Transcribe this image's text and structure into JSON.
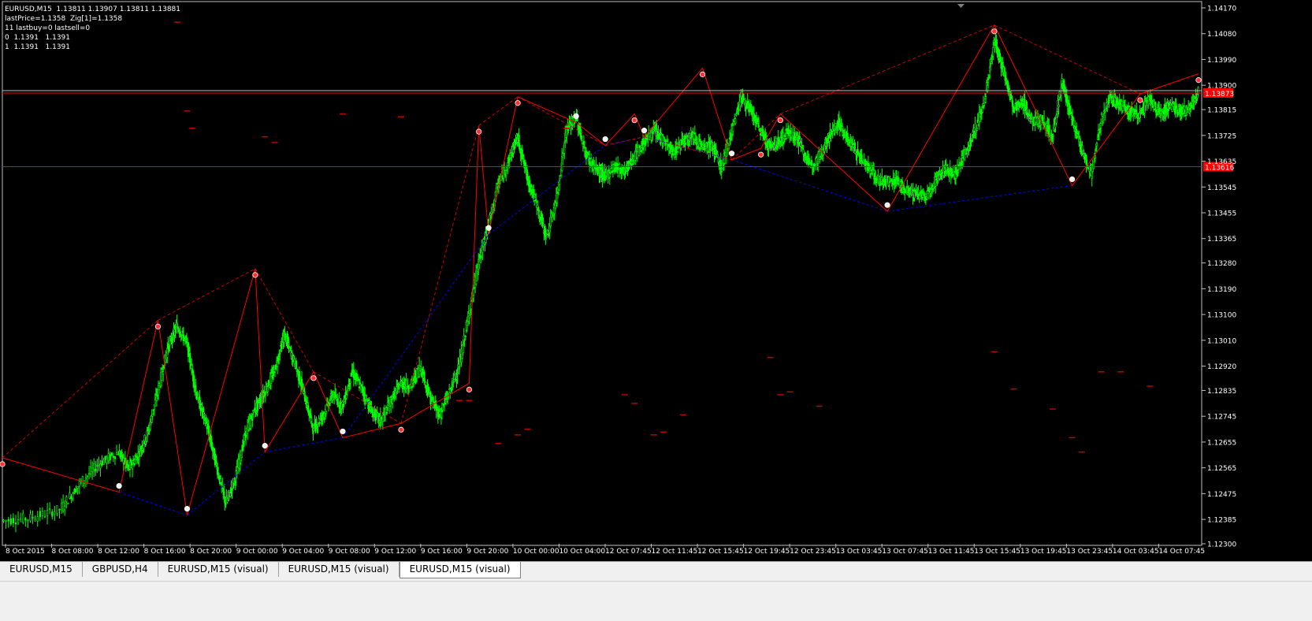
{
  "chart_data": {
    "type": "candlestick",
    "symbol_line": "EURUSD,M15  1.13811 1.13907 1.13811 1.13881",
    "info_lines": [
      "lastPrice=1.1358  Zig[1]=1.1358",
      "11 lastbuy=0 lastsell=0",
      "0  1.1391   1.1391",
      "1  1.1391   1.1391"
    ],
    "y_ticks": [
      "1.14170",
      "1.14080",
      "1.13990",
      "1.13900",
      "1.13815",
      "1.13725",
      "1.13635",
      "1.13545",
      "1.13455",
      "1.13365",
      "1.13280",
      "1.13190",
      "1.13100",
      "1.13010",
      "1.12920",
      "1.12835",
      "1.12745",
      "1.12655",
      "1.12565",
      "1.12475",
      "1.12385",
      "1.12300"
    ],
    "ylim": [
      1.123,
      1.1417
    ],
    "x_ticks": [
      "8 Oct 2015",
      "8 Oct 08:00",
      "8 Oct 12:00",
      "8 Oct 16:00",
      "8 Oct 20:00",
      "9 Oct 00:00",
      "9 Oct 04:00",
      "9 Oct 08:00",
      "9 Oct 12:00",
      "9 Oct 16:00",
      "9 Oct 20:00",
      "10 Oct 00:00",
      "10 Oct 04:00",
      "12 Oct 07:45",
      "12 Oct 11:45",
      "12 Oct 15:45",
      "12 Oct 19:45",
      "12 Oct 23:45",
      "13 Oct 03:45",
      "13 Oct 07:45",
      "13 Oct 11:45",
      "13 Oct 15:45",
      "13 Oct 19:45",
      "13 Oct 23:45",
      "14 Oct 03:45",
      "14 Oct 07:45"
    ],
    "hlines": [
      {
        "price": 1.13873,
        "label": "1.13873",
        "color": "#ff0000"
      },
      {
        "price": 1.13616,
        "label": "1.13616",
        "color": "#ff0000"
      }
    ],
    "close_path": [
      [
        0,
        1.1238
      ],
      [
        3,
        1.1239
      ],
      [
        6,
        1.1242
      ],
      [
        8,
        1.1251
      ],
      [
        10,
        1.1258
      ],
      [
        12,
        1.1262
      ],
      [
        13,
        1.1256
      ],
      [
        14,
        1.1261
      ],
      [
        15,
        1.1269
      ],
      [
        16,
        1.1283
      ],
      [
        17,
        1.1298
      ],
      [
        18,
        1.1306
      ],
      [
        19,
        1.13
      ],
      [
        20,
        1.1282
      ],
      [
        21,
        1.1272
      ],
      [
        22,
        1.1258
      ],
      [
        23,
        1.1244
      ],
      [
        24,
        1.1253
      ],
      [
        25,
        1.1268
      ],
      [
        26,
        1.1277
      ],
      [
        27,
        1.1283
      ],
      [
        28,
        1.129
      ],
      [
        29,
        1.1303
      ],
      [
        30,
        1.1294
      ],
      [
        31,
        1.1283
      ],
      [
        32,
        1.127
      ],
      [
        33,
        1.1275
      ],
      [
        34,
        1.1282
      ],
      [
        35,
        1.1278
      ],
      [
        36,
        1.129
      ],
      [
        37,
        1.1284
      ],
      [
        38,
        1.1276
      ],
      [
        39,
        1.1273
      ],
      [
        40,
        1.128
      ],
      [
        41,
        1.1286
      ],
      [
        42,
        1.1285
      ],
      [
        43,
        1.1292
      ],
      [
        44,
        1.1281
      ],
      [
        45,
        1.1275
      ],
      [
        46,
        1.1283
      ],
      [
        47,
        1.1292
      ],
      [
        48,
        1.131
      ],
      [
        49,
        1.1328
      ],
      [
        50,
        1.1341
      ],
      [
        51,
        1.1355
      ],
      [
        52,
        1.1363
      ],
      [
        53,
        1.1372
      ],
      [
        54,
        1.1358
      ],
      [
        55,
        1.1348
      ],
      [
        56,
        1.1337
      ],
      [
        57,
        1.135
      ],
      [
        58,
        1.1374
      ],
      [
        59,
        1.1379
      ],
      [
        60,
        1.1366
      ],
      [
        61,
        1.1361
      ],
      [
        62,
        1.1358
      ],
      [
        63,
        1.1362
      ],
      [
        64,
        1.136
      ],
      [
        65,
        1.1365
      ],
      [
        66,
        1.137
      ],
      [
        67,
        1.1374
      ],
      [
        68,
        1.1371
      ],
      [
        69,
        1.1366
      ],
      [
        70,
        1.1371
      ],
      [
        71,
        1.1373
      ],
      [
        72,
        1.1368
      ],
      [
        73,
        1.1369
      ],
      [
        74,
        1.1361
      ],
      [
        75,
        1.1374
      ],
      [
        76,
        1.1386
      ],
      [
        77,
        1.1381
      ],
      [
        78,
        1.1374
      ],
      [
        79,
        1.1368
      ],
      [
        80,
        1.1371
      ],
      [
        81,
        1.1374
      ],
      [
        82,
        1.137
      ],
      [
        83,
        1.1362
      ],
      [
        84,
        1.1365
      ],
      [
        85,
        1.1372
      ],
      [
        86,
        1.1377
      ],
      [
        87,
        1.1371
      ],
      [
        88,
        1.1366
      ],
      [
        89,
        1.1362
      ],
      [
        90,
        1.1357
      ],
      [
        91,
        1.1356
      ],
      [
        92,
        1.1357
      ],
      [
        93,
        1.1353
      ],
      [
        94,
        1.1352
      ],
      [
        95,
        1.1351
      ],
      [
        96,
        1.1357
      ],
      [
        97,
        1.1361
      ],
      [
        98,
        1.1359
      ],
      [
        99,
        1.1366
      ],
      [
        100,
        1.1374
      ],
      [
        101,
        1.1384
      ],
      [
        102,
        1.1405
      ],
      [
        103,
        1.1395
      ],
      [
        104,
        1.1382
      ],
      [
        105,
        1.1384
      ],
      [
        106,
        1.1377
      ],
      [
        107,
        1.1378
      ],
      [
        108,
        1.1372
      ],
      [
        109,
        1.1391
      ],
      [
        110,
        1.1378
      ],
      [
        111,
        1.1368
      ],
      [
        112,
        1.1359
      ],
      [
        113,
        1.1378
      ],
      [
        114,
        1.1386
      ],
      [
        115,
        1.1383
      ],
      [
        116,
        1.1381
      ],
      [
        117,
        1.138
      ],
      [
        118,
        1.1385
      ],
      [
        119,
        1.138
      ],
      [
        120,
        1.1383
      ],
      [
        121,
        1.1381
      ],
      [
        122,
        1.1381
      ],
      [
        123,
        1.1388
      ]
    ],
    "zigzag_red": [
      [
        0,
        1.126
      ],
      [
        12,
        1.1248
      ],
      [
        16,
        1.1308
      ],
      [
        19,
        1.124
      ],
      [
        26,
        1.1326
      ],
      [
        27,
        1.1262
      ],
      [
        32,
        1.129
      ],
      [
        35,
        1.1267
      ],
      [
        41,
        1.1272
      ],
      [
        48,
        1.1286
      ],
      [
        49,
        1.1376
      ],
      [
        50,
        1.1338
      ],
      [
        53,
        1.1386
      ],
      [
        59,
        1.1377
      ],
      [
        62,
        1.1369
      ],
      [
        65,
        1.138
      ],
      [
        66,
        1.1372
      ],
      [
        72,
        1.1396
      ],
      [
        75,
        1.1364
      ],
      [
        78,
        1.1368
      ],
      [
        80,
        1.138
      ],
      [
        91,
        1.1346
      ],
      [
        102,
        1.1411
      ],
      [
        110,
        1.1355
      ],
      [
        117,
        1.1387
      ],
      [
        123,
        1.1394
      ]
    ],
    "levels_red": [
      [
        18,
        1.1412
      ],
      [
        19,
        1.1381
      ],
      [
        19.5,
        1.1375
      ],
      [
        27,
        1.1372
      ],
      [
        28,
        1.137
      ],
      [
        35,
        1.138
      ],
      [
        41,
        1.1379
      ],
      [
        47,
        1.128
      ],
      [
        48,
        1.128
      ],
      [
        51,
        1.1265
      ],
      [
        53,
        1.1268
      ],
      [
        54,
        1.127
      ],
      [
        58,
        1.1375
      ],
      [
        64,
        1.1282
      ],
      [
        65,
        1.1279
      ],
      [
        67,
        1.1268
      ],
      [
        68,
        1.1269
      ],
      [
        70,
        1.1275
      ],
      [
        79,
        1.1295
      ],
      [
        80,
        1.1282
      ],
      [
        81,
        1.1283
      ],
      [
        84,
        1.1278
      ],
      [
        102,
        1.1297
      ],
      [
        104,
        1.1284
      ],
      [
        108,
        1.1277
      ],
      [
        110,
        1.1267
      ],
      [
        111,
        1.1262
      ],
      [
        113,
        1.129
      ],
      [
        115,
        1.129
      ],
      [
        118,
        1.1285
      ]
    ],
    "legend": "none",
    "grid": false
  },
  "tabs": [
    {
      "label": "EURUSD,M15",
      "active": false
    },
    {
      "label": "GBPUSD,H4",
      "active": false
    },
    {
      "label": "EURUSD,M15 (visual)",
      "active": false
    },
    {
      "label": "EURUSD,M15 (visual)",
      "active": false
    },
    {
      "label": "EURUSD,M15 (visual)",
      "active": true
    }
  ],
  "colors": {
    "background": "#000000",
    "bull": "#00ff00",
    "bear": "#ffffff",
    "zigzag": "#ff0000",
    "trend_blue": "#0000ff",
    "axis_text": "#ffffff"
  }
}
